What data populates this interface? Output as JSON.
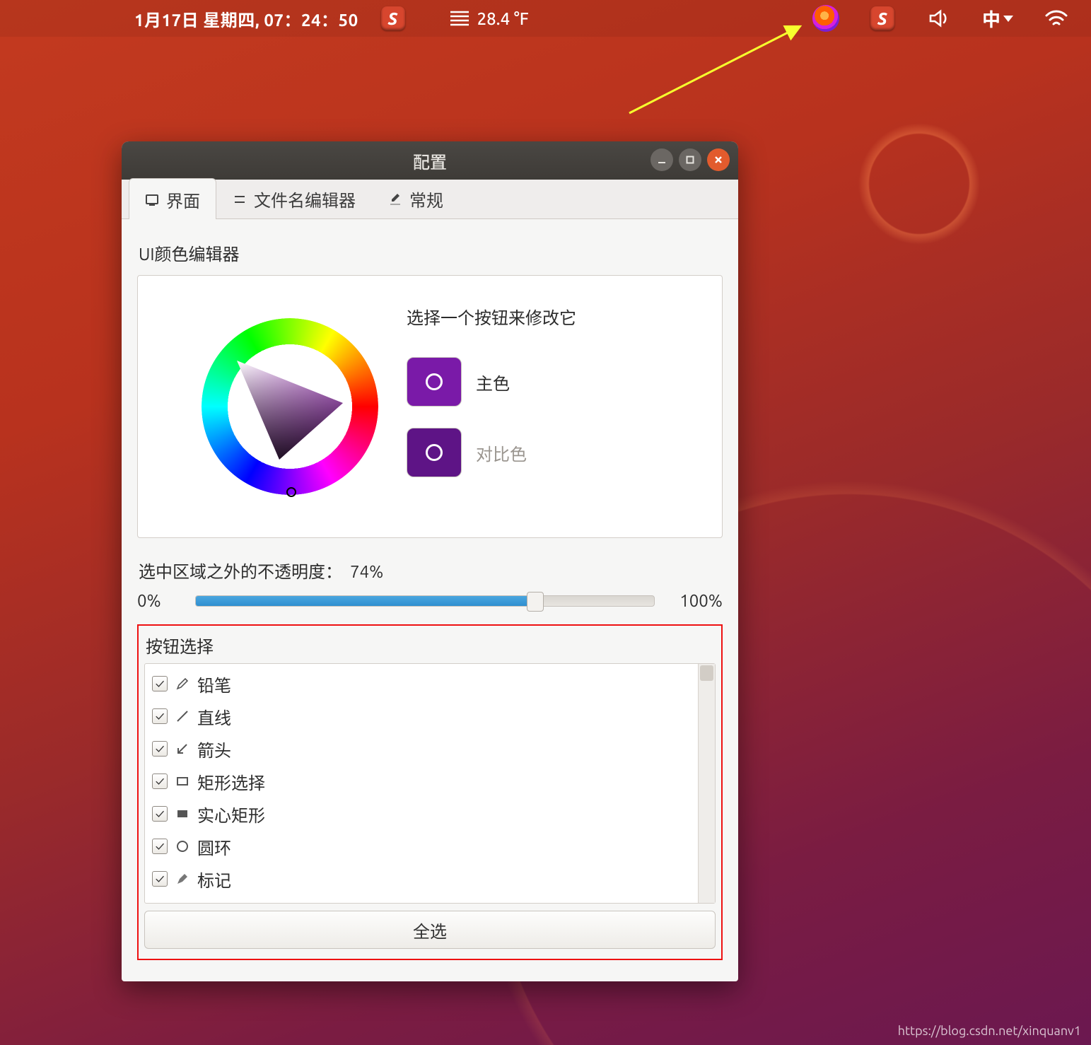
{
  "panel": {
    "clock": "1月17日 星期四, 07：24：50",
    "temperature": "28.4 °F",
    "ime": "中"
  },
  "window": {
    "title": "配置",
    "tabs": {
      "interface": "界面",
      "filename_editor": "文件名编辑器",
      "general": "常规"
    }
  },
  "color_editor": {
    "section_label": "UI颜色编辑器",
    "prompt": "选择一个按钮来修改它",
    "primary": {
      "label": "主色",
      "hex": "#7a1aa8"
    },
    "contrast": {
      "label": "对比色",
      "hex": "#5e1486"
    }
  },
  "opacity": {
    "label": "选中区域之外的不透明度：",
    "value": "74%",
    "min": "0%",
    "max": "100%"
  },
  "tools": {
    "section_label": "按钮选择",
    "select_all": "全选",
    "items": [
      {
        "label": "铅笔",
        "icon": "pencil"
      },
      {
        "label": "直线",
        "icon": "line"
      },
      {
        "label": "箭头",
        "icon": "arrow"
      },
      {
        "label": "矩形选择",
        "icon": "rect"
      },
      {
        "label": "实心矩形",
        "icon": "rect-solid"
      },
      {
        "label": "圆环",
        "icon": "circle"
      },
      {
        "label": "标记",
        "icon": "marker"
      }
    ]
  },
  "watermark": "https://blog.csdn.net/xinquanv1"
}
